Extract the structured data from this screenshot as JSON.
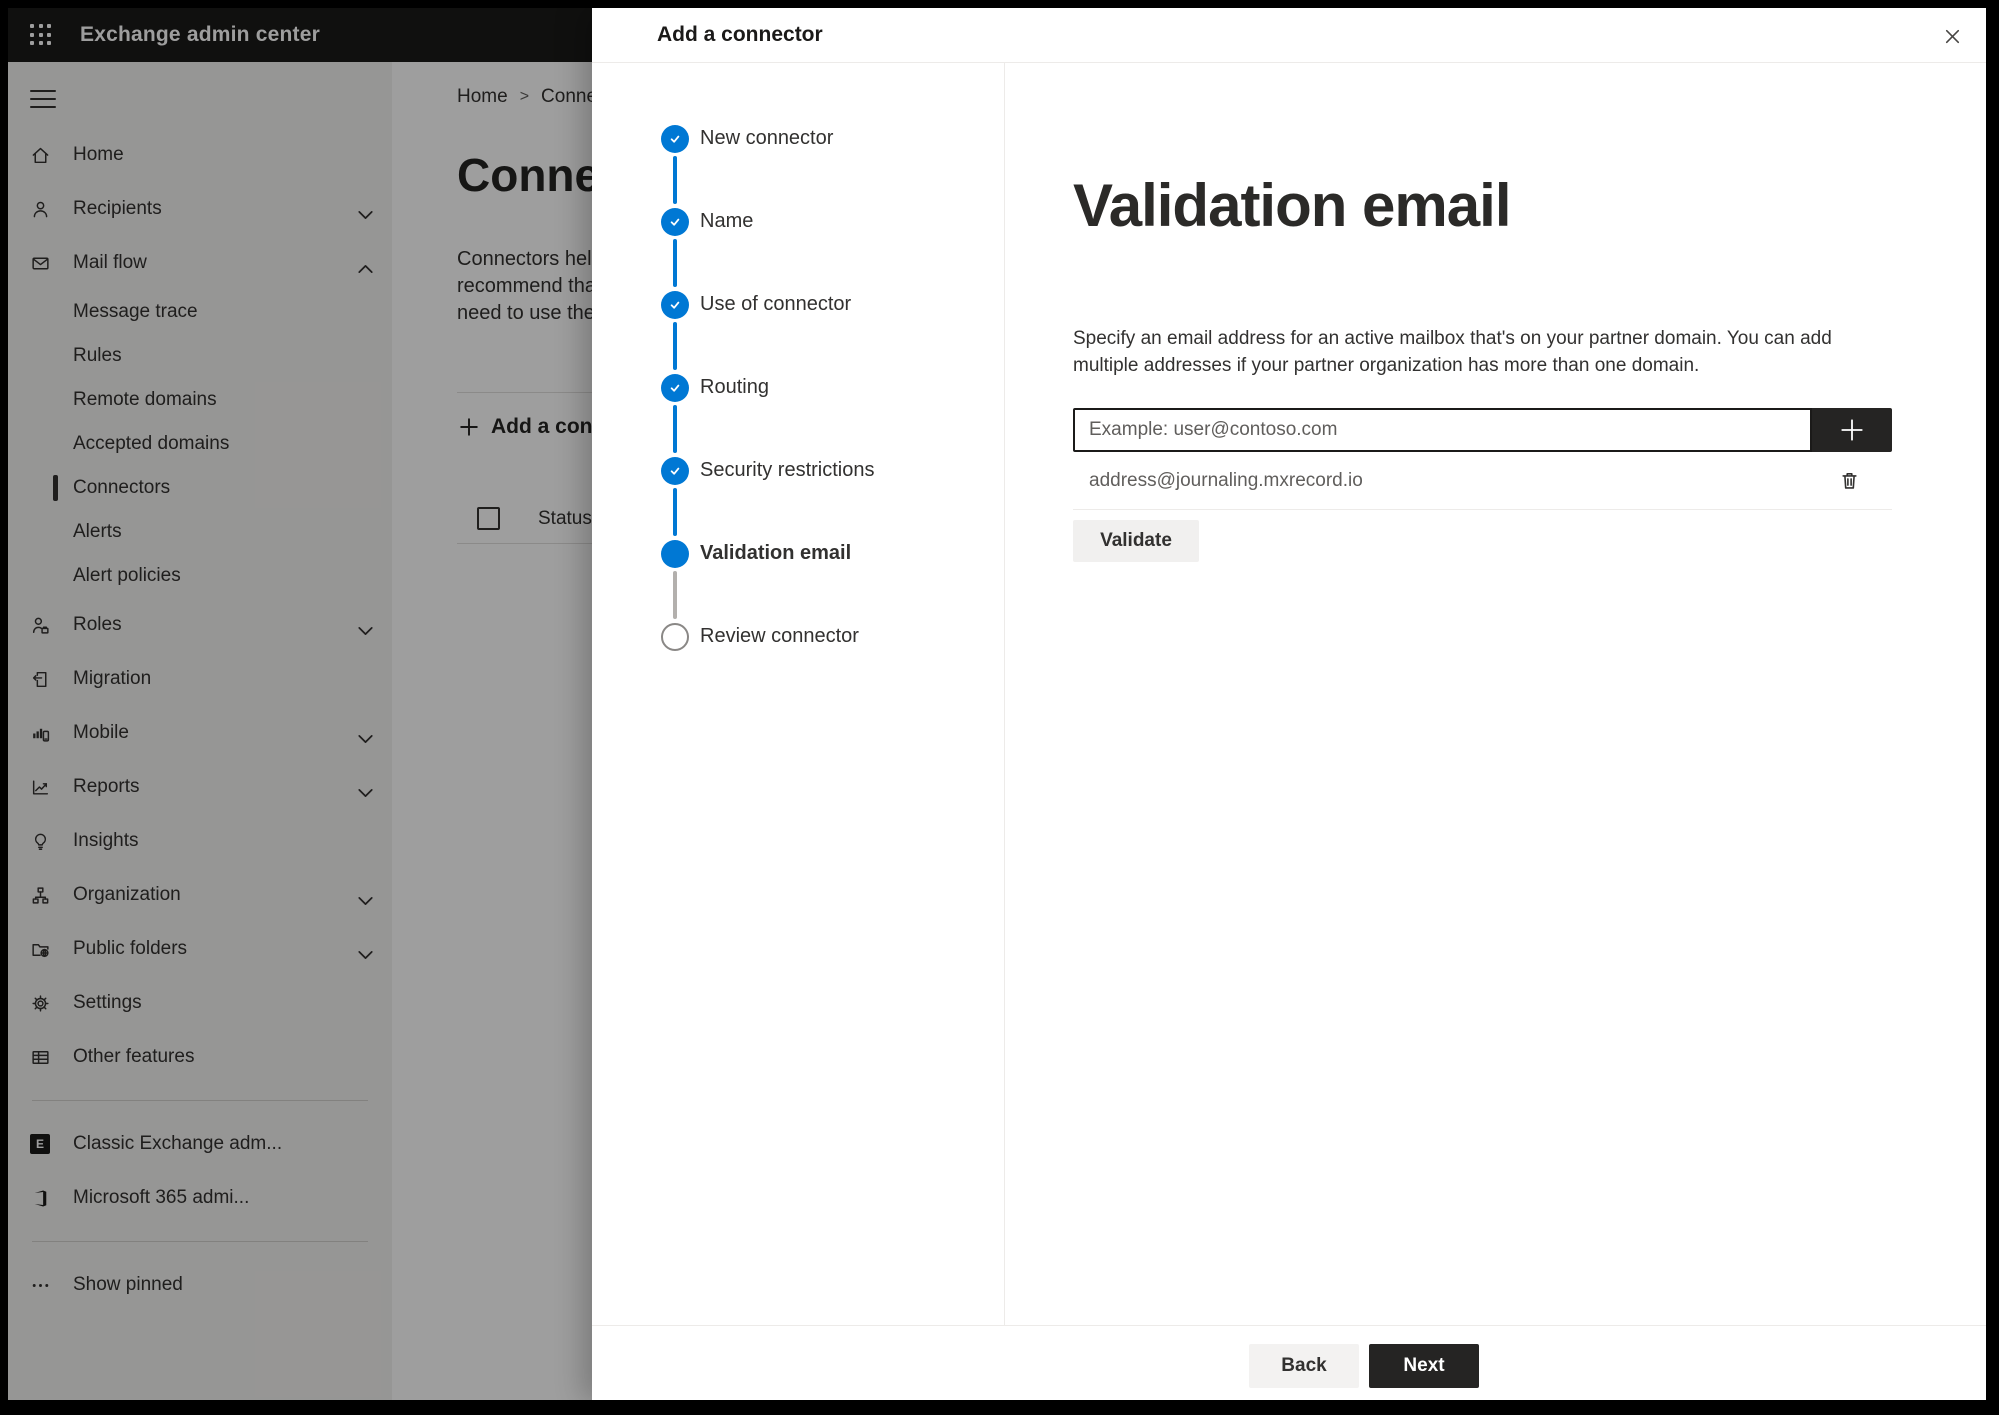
{
  "colors": {
    "accent": "#0078d4",
    "topbar_bg": "#1b1a19",
    "dark_button_bg": "#252423",
    "sidebar_bg": "#f3f2f1",
    "selected_marker": "#323130"
  },
  "topbar": {
    "title": "Exchange admin center",
    "app_launcher_icon": "waffle-grid"
  },
  "sidebar": {
    "items": [
      {
        "label": "Home",
        "icon": "home-icon"
      },
      {
        "label": "Recipients",
        "icon": "person-icon",
        "chevron": "down"
      },
      {
        "label": "Mail flow",
        "icon": "envelope-icon",
        "chevron": "up",
        "expanded": true
      },
      {
        "label": "Message trace",
        "sub": true
      },
      {
        "label": "Rules",
        "sub": true
      },
      {
        "label": "Remote domains",
        "sub": true
      },
      {
        "label": "Accepted domains",
        "sub": true
      },
      {
        "label": "Connectors",
        "sub": true,
        "selected": true
      },
      {
        "label": "Alerts",
        "sub": true
      },
      {
        "label": "Alert policies",
        "sub": true
      },
      {
        "label": "Roles",
        "icon": "person-badge-icon",
        "chevron": "down"
      },
      {
        "label": "Migration",
        "icon": "document-arrow-icon"
      },
      {
        "label": "Mobile",
        "icon": "chart-phone-icon",
        "chevron": "down"
      },
      {
        "label": "Reports",
        "icon": "line-chart-icon",
        "chevron": "down"
      },
      {
        "label": "Insights",
        "icon": "lightbulb-icon"
      },
      {
        "label": "Organization",
        "icon": "org-tree-icon",
        "chevron": "down"
      },
      {
        "label": "Public folders",
        "icon": "folder-globe-icon",
        "chevron": "down"
      },
      {
        "label": "Settings",
        "icon": "gear-icon"
      },
      {
        "label": "Other features",
        "icon": "table-icon"
      },
      {
        "label": "Classic Exchange adm...",
        "icon": "exchange-logo"
      },
      {
        "label": "Microsoft 365 admi...",
        "icon": "office-logo"
      },
      {
        "label": "Show pinned",
        "icon": "ellipsis-icon"
      }
    ]
  },
  "page": {
    "breadcrumb": {
      "root": "Home",
      "separator": ">",
      "current": "Conne"
    },
    "title": "Connect",
    "intro_lines": "Connectors help\nrecommend that\nneed to use ther",
    "add_connector_button": "Add a conn",
    "table": {
      "status_header": "Status"
    }
  },
  "modal": {
    "title": "Add a connector",
    "steps": [
      {
        "label": "New connector",
        "state": "completed"
      },
      {
        "label": "Name",
        "state": "completed"
      },
      {
        "label": "Use of connector",
        "state": "completed"
      },
      {
        "label": "Routing",
        "state": "completed"
      },
      {
        "label": "Security restrictions",
        "state": "completed"
      },
      {
        "label": "Validation email",
        "state": "current"
      },
      {
        "label": "Review connector",
        "state": "upcoming"
      }
    ],
    "content": {
      "heading": "Validation email",
      "description": "Specify an email address for an active mailbox that's on your partner domain. You can add multiple addresses if your partner organization has more than one domain.",
      "email_placeholder": "Example: user@contoso.com",
      "email_value": "",
      "addresses": [
        {
          "email": "address@journaling.mxrecord.io"
        }
      ],
      "validate_button": "Validate"
    },
    "footer": {
      "back_button": "Back",
      "next_button": "Next"
    }
  }
}
